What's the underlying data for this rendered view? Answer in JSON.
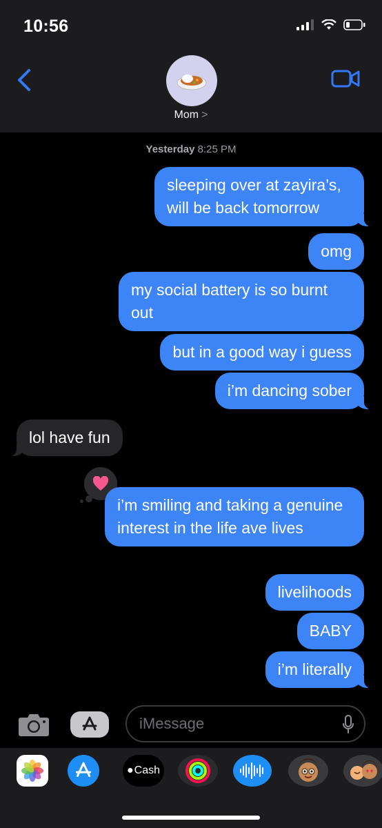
{
  "status_bar": {
    "time": "10:56"
  },
  "header": {
    "contact_name": "Mom",
    "chevron": ">",
    "avatar_icon": "curry-rice-emoji"
  },
  "conversation": {
    "timestamp_day": "Yesterday",
    "timestamp_time": "8:25 PM",
    "messages": [
      {
        "from": "me",
        "text": "sleeping over at zayira’s, will be back tomorrow"
      },
      {
        "from": "me",
        "text": "omg"
      },
      {
        "from": "me",
        "text": "my social battery is so burnt out"
      },
      {
        "from": "me",
        "text": "but in a good way i guess"
      },
      {
        "from": "me",
        "text": "i’m dancing sober"
      },
      {
        "from": "them",
        "text": "lol have fun"
      },
      {
        "from": "me",
        "text": "i’m smiling and taking a genuine interest in the life ave lives",
        "tapback": "heart"
      },
      {
        "from": "me",
        "text": "livelihoods"
      },
      {
        "from": "me",
        "text": "BABY"
      },
      {
        "from": "me",
        "text": "i’m literally"
      }
    ]
  },
  "input_bar": {
    "placeholder": "iMessage"
  },
  "app_drawer": {
    "apps": [
      "photos-icon",
      "app-store-icon",
      "apple-cash-icon",
      "activity-icon",
      "audio-message-icon",
      "memoji-icon",
      "memoji-stickers-icon"
    ],
    "cash_label": "Cash"
  },
  "colors": {
    "outgoing_bubble": "#3d84f7",
    "incoming_bubble": "#262628",
    "accent": "#3478f6"
  }
}
